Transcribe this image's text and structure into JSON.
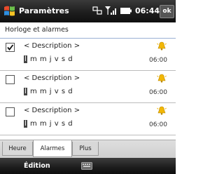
{
  "window": {
    "title": "Paramètres",
    "time": "06:44",
    "ok_label": "ok"
  },
  "header": {
    "title": "Horloge et alarmes"
  },
  "alarms": [
    {
      "description": "< Description >",
      "days_first": "l",
      "days_rest": "m m j v s d",
      "time": "06:00",
      "checked": true
    },
    {
      "description": "< Description >",
      "days_first": "l",
      "days_rest": "m m j v s d",
      "time": "06:00",
      "checked": false
    },
    {
      "description": "< Description >",
      "days_first": "l",
      "days_rest": "m m j v s d",
      "time": "06:00",
      "checked": false
    }
  ],
  "tabs": [
    {
      "label": "Heure",
      "active": false
    },
    {
      "label": "Alarmes",
      "active": true
    },
    {
      "label": "Plus",
      "active": false
    }
  ],
  "softkeys": {
    "left": "Édition"
  },
  "icons": {
    "logo": "windows-flag-icon",
    "network": "network-sync-icon",
    "signal": "signal-strength-icon",
    "battery": "battery-icon",
    "bell": "alarm-bell-icon",
    "keyboard": "keyboard-icon"
  },
  "colors": {
    "bar_bg": "#1e1e1e",
    "header_rule": "#9ab0d4",
    "bell": "#f2b705"
  }
}
